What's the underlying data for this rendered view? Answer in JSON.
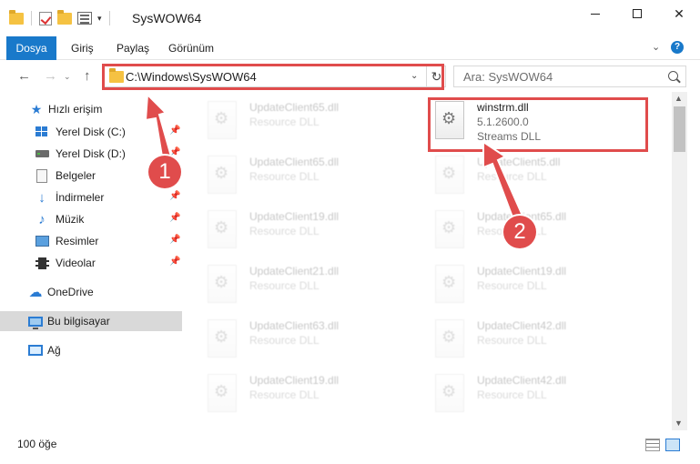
{
  "window": {
    "title": "SysWOW64",
    "minimize": "—",
    "maximize": "□",
    "close": "✕"
  },
  "ribbon": {
    "tabs": [
      {
        "label": "Dosya"
      },
      {
        "label": "Giriş"
      },
      {
        "label": "Paylaş"
      },
      {
        "label": "Görünüm"
      }
    ],
    "chevron": "⌄",
    "help": "?"
  },
  "nav": {
    "back": "←",
    "forward": "→",
    "recent": "⌄",
    "up": "↑",
    "address": "C:\\Windows\\SysWOW64",
    "address_dropdown": "⌄",
    "refresh": "↻",
    "search_placeholder": "Ara: SysWOW64"
  },
  "sidebar": {
    "items": [
      {
        "label": "Hızlı erişim",
        "icon": "star-icon"
      },
      {
        "label": "Yerel Disk (C:)",
        "icon": "windows-drive-icon",
        "pinned": true
      },
      {
        "label": "Yerel Disk (D:)",
        "icon": "drive-icon",
        "pinned": true
      },
      {
        "label": "Belgeler",
        "icon": "documents-icon",
        "pinned": true
      },
      {
        "label": "İndirmeler",
        "icon": "downloads-icon",
        "pinned": true
      },
      {
        "label": "Müzik",
        "icon": "music-icon",
        "pinned": true
      },
      {
        "label": "Resimler",
        "icon": "pictures-icon",
        "pinned": true
      },
      {
        "label": "Videolar",
        "icon": "videos-icon",
        "pinned": true
      },
      {
        "label": "OneDrive",
        "icon": "onedrive-icon"
      },
      {
        "label": "Bu bilgisayar",
        "icon": "this-pc-icon",
        "selected": true
      },
      {
        "label": "Ağ",
        "icon": "network-icon"
      }
    ],
    "pin_glyph": "📌"
  },
  "files": {
    "left_column": [
      {
        "name": "UpdateClient65.dll",
        "meta": "Resource DLL"
      },
      {
        "name": "UpdateClient65.dll",
        "meta": "Resource DLL"
      },
      {
        "name": "UpdateClient19.dll",
        "meta": "Resource DLL"
      },
      {
        "name": "UpdateClient21.dll",
        "meta": "Resource DLL"
      },
      {
        "name": "UpdateClient63.dll",
        "meta": "Resource DLL"
      },
      {
        "name": "UpdateClient19.dll",
        "meta": "Resource DLL"
      }
    ],
    "right_column": [
      {
        "name": "winstrm.dll",
        "version": "5.1.2600.0",
        "description": "Streams DLL"
      },
      {
        "name": "UpdateClient5.dll",
        "meta": "Resource DLL"
      },
      {
        "name": "UpdateClient65.dll",
        "meta": "Resource DLL"
      },
      {
        "name": "UpdateClient19.dll",
        "meta": "Resource DLL"
      },
      {
        "name": "UpdateClient42.dll",
        "meta": "Resource DLL"
      },
      {
        "name": "UpdateClient42.dll",
        "meta": "Resource DLL"
      }
    ]
  },
  "status": {
    "count": "100 öğe"
  },
  "annotations": {
    "badge1": "1",
    "badge2": "2",
    "color": "#e04c4c"
  },
  "scrollbar": {
    "up": "▲",
    "down": "▼"
  }
}
